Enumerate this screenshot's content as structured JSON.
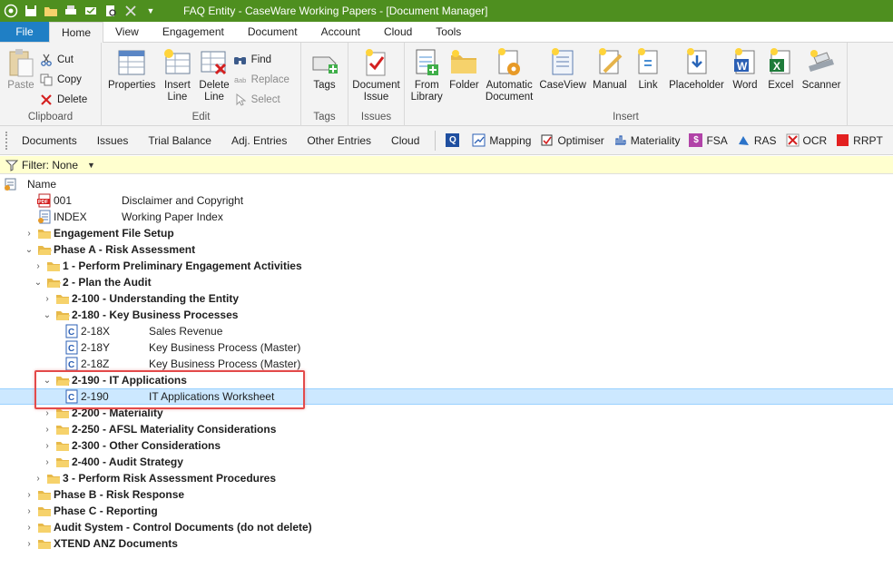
{
  "window": {
    "title": "FAQ Entity - CaseWare Working Papers - [Document Manager]"
  },
  "ribbon_tabs": [
    "File",
    "Home",
    "View",
    "Engagement",
    "Document",
    "Account",
    "Cloud",
    "Tools"
  ],
  "clipboard": {
    "paste": "Paste",
    "cut": "Cut",
    "copy": "Copy",
    "delete": "Delete",
    "label": "Clipboard"
  },
  "edit": {
    "properties": "Properties",
    "insert_line": "Insert\nLine",
    "delete_line": "Delete\nLine",
    "find": "Find",
    "replace": "Replace",
    "select": "Select",
    "label": "Edit"
  },
  "tags": {
    "button": "Tags",
    "label": "Tags"
  },
  "issues": {
    "button": "Document\nIssue",
    "label": "Issues"
  },
  "insert": {
    "buttons": [
      "From\nLibrary",
      "Folder",
      "Automatic\nDocument",
      "CaseView",
      "Manual",
      "Link",
      "Placeholder",
      "Word",
      "Excel",
      "Scanner"
    ],
    "label": "Insert"
  },
  "toolbar2": {
    "nav": [
      "Documents",
      "Issues",
      "Trial Balance",
      "Adj. Entries",
      "Other Entries",
      "Cloud"
    ],
    "tools": [
      "Mapping",
      "Optimiser",
      "Materiality",
      "FSA",
      "RAS",
      "OCR",
      "RRPT"
    ]
  },
  "filter": {
    "text": "Filter: None"
  },
  "column": {
    "name": "Name"
  },
  "tree": [
    {
      "id": "001",
      "desc": "Disclaimer and Copyright",
      "icon": "pdf-icon"
    },
    {
      "id": "INDEX",
      "desc": "Working Paper Index",
      "icon": "index-icon"
    },
    {
      "label": "Engagement File Setup"
    },
    {
      "label": "Phase A - Risk Assessment"
    },
    {
      "label": "1 - Perform Preliminary Engagement Activities"
    },
    {
      "label": "2 - Plan the Audit"
    },
    {
      "label": "2-100 - Understanding the Entity"
    },
    {
      "label": "2-180 - Key Business Processes"
    },
    {
      "id": "2-18X",
      "desc": "Sales Revenue"
    },
    {
      "id": "2-18Y",
      "desc": "Key Business Process (Master)"
    },
    {
      "id": "2-18Z",
      "desc": "Key Business Process (Master)"
    },
    {
      "label": "2-190 - IT Applications"
    },
    {
      "id": "2-190",
      "desc": "IT Applications Worksheet"
    },
    {
      "label": "2-200 - Materiality"
    },
    {
      "label": "2-250 - AFSL Materiality Considerations"
    },
    {
      "label": "2-300 - Other Considerations"
    },
    {
      "label": "2-400 - Audit Strategy"
    },
    {
      "label": "3 - Perform Risk Assessment Procedures"
    },
    {
      "label": "Phase B - Risk Response"
    },
    {
      "label": "Phase C - Reporting"
    },
    {
      "label": "Audit System - Control Documents (do not delete)"
    },
    {
      "label": "XTEND ANZ Documents"
    }
  ],
  "colors": {
    "titlebar": "#4e8f1f",
    "file_tab": "#1f7fc5",
    "selected_row": "#cce8ff",
    "highlight": "#e34a4a"
  }
}
